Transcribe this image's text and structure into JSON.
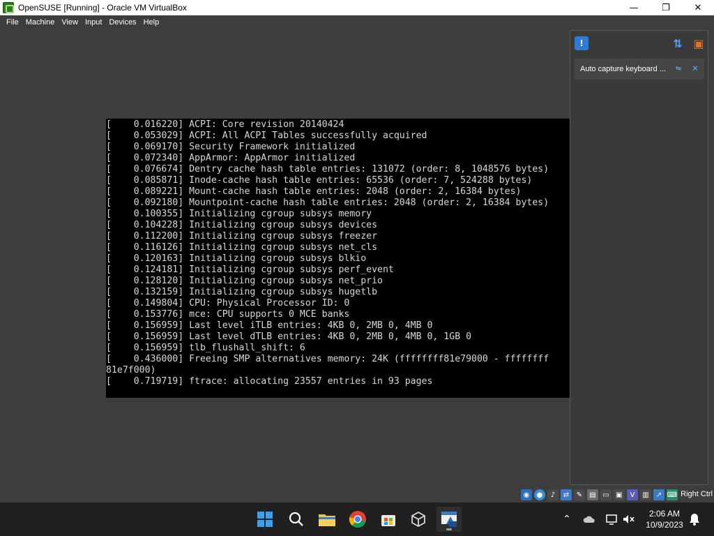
{
  "window": {
    "title": "OpenSUSE [Running] - Oracle VM VirtualBox",
    "controls": {
      "minimize": "—",
      "maximize": "❐",
      "close": "✕"
    }
  },
  "menu": [
    "File",
    "Machine",
    "View",
    "Input",
    "Devices",
    "Help"
  ],
  "console": {
    "lines": [
      "[    0.016220] ACPI: Core revision 20140424",
      "[    0.053029] ACPI: All ACPI Tables successfully acquired",
      "[    0.069170] Security Framework initialized",
      "[    0.072340] AppArmor: AppArmor initialized",
      "[    0.076674] Dentry cache hash table entries: 131072 (order: 8, 1048576 bytes)",
      "[    0.085871] Inode-cache hash table entries: 65536 (order: 7, 524288 bytes)",
      "[    0.089221] Mount-cache hash table entries: 2048 (order: 2, 16384 bytes)",
      "[    0.092180] Mountpoint-cache hash table entries: 2048 (order: 2, 16384 bytes)",
      "[    0.100355] Initializing cgroup subsys memory",
      "[    0.104228] Initializing cgroup subsys devices",
      "[    0.112200] Initializing cgroup subsys freezer",
      "[    0.116126] Initializing cgroup subsys net_cls",
      "[    0.120163] Initializing cgroup subsys blkio",
      "[    0.124181] Initializing cgroup subsys perf_event",
      "[    0.128120] Initializing cgroup subsys net_prio",
      "[    0.132159] Initializing cgroup subsys hugetlb",
      "[    0.149804] CPU: Physical Processor ID: 0",
      "[    0.153776] mce: CPU supports 0 MCE banks",
      "[    0.156959] Last level iTLB entries: 4KB 0, 2MB 0, 4MB 0",
      "[    0.156959] Last level dTLB entries: 4KB 0, 2MB 0, 4MB 0, 1GB 0",
      "[    0.156959] tlb_flushall_shift: 6",
      "[    0.436000] Freeing SMP alternatives memory: 24K (ffffffff81e79000 - ffffffff",
      "81e7f000)",
      "[    0.719719] ftrace: allocating 23557 entries in 93 pages"
    ]
  },
  "notification_panel": {
    "message": "Auto capture keyboard ...",
    "icons": {
      "messages": "message-icon",
      "sort": "sort-icon",
      "clear": "clear-all-icon"
    }
  },
  "statusbar": {
    "host_key": "Right Ctrl",
    "indicator_icons": [
      "hard-disk-icon",
      "optical-drive-icon",
      "audio-icon",
      "network-icon",
      "usb-icon",
      "shared-folders-icon",
      "display-icon",
      "video-capture-icon",
      "recording-icon",
      "cpu-icon",
      "mouse-integration-icon",
      "keyboard-icon"
    ]
  },
  "taskbar": {
    "apps": [
      "windows-start-icon",
      "search-icon",
      "file-explorer-icon",
      "chrome-icon",
      "microsoft-store-icon",
      "virtualbox-icon",
      "virtualbox-vm-icon"
    ],
    "clock": {
      "time": "2:06 AM",
      "date": "10/9/2023"
    }
  }
}
